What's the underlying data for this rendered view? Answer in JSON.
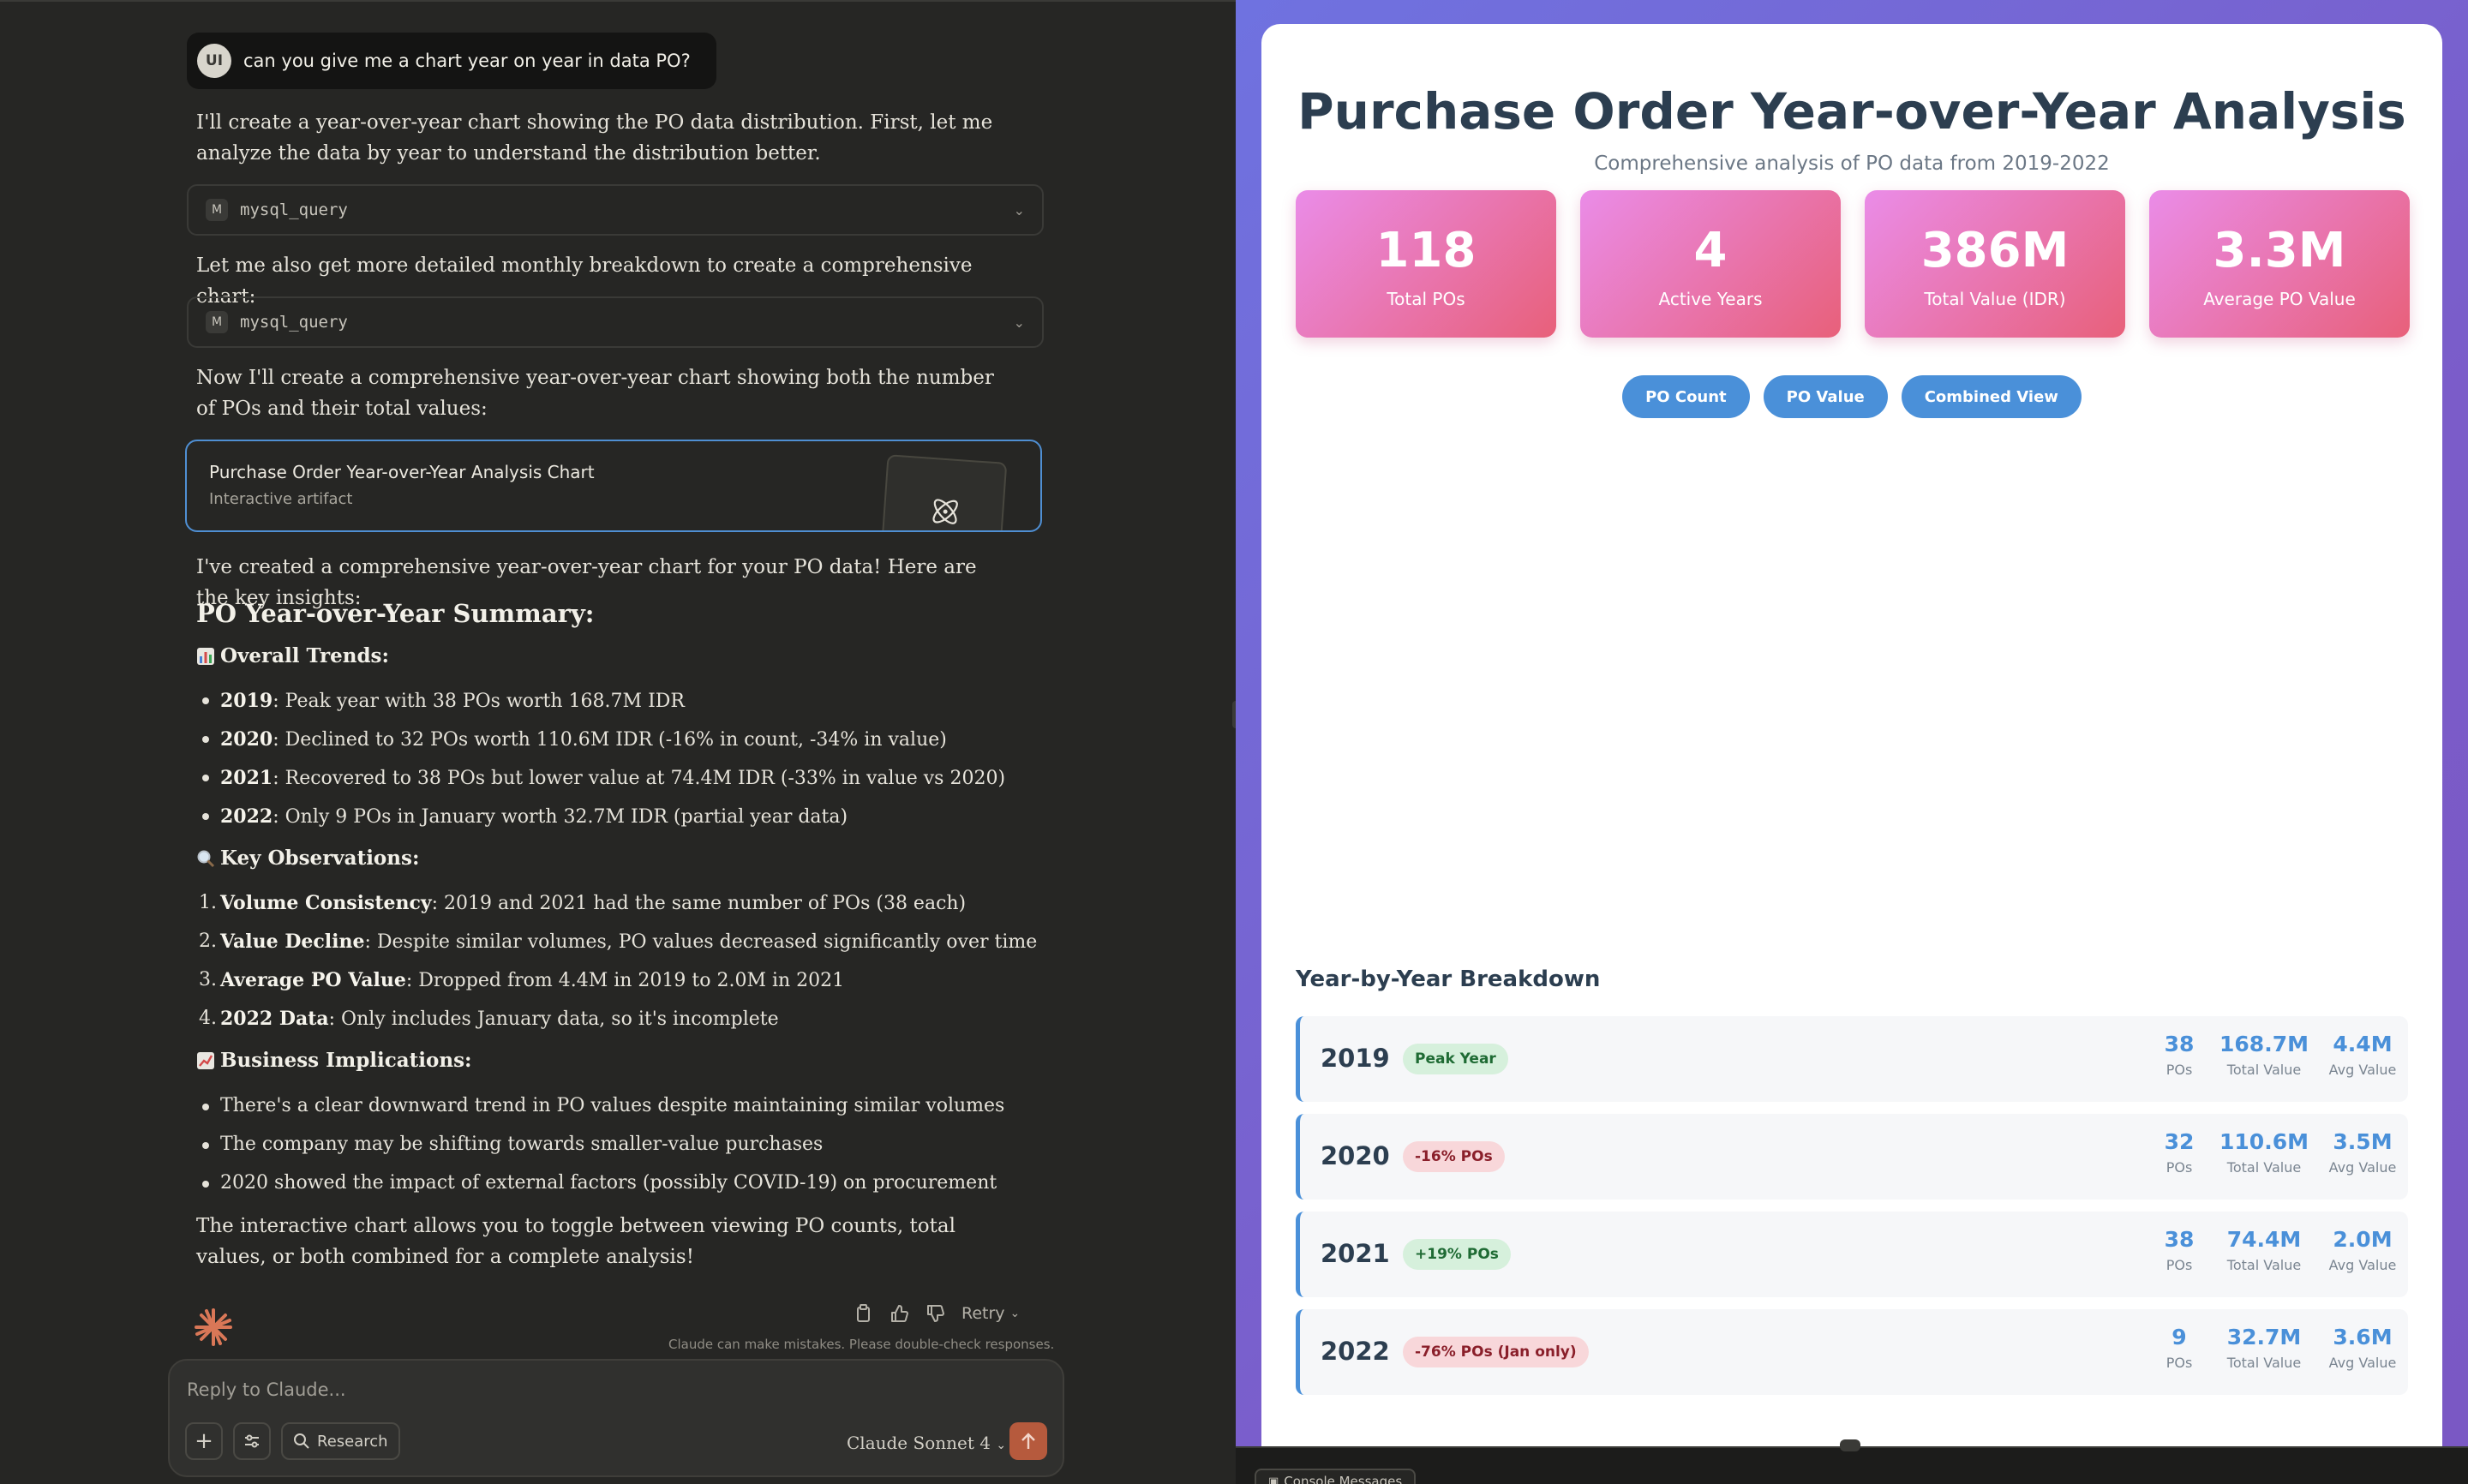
{
  "chat": {
    "user_initials": "UI",
    "user_message": "can you give me a chart year on year in data PO?",
    "para1": "I'll create a year-over-year chart showing the PO data distribution. First, let me analyze the data by year to understand the distribution better.",
    "tool1": {
      "badge": "M",
      "name": "mysql_query"
    },
    "para2": "Let me also get more detailed monthly breakdown to create a comprehensive chart:",
    "tool2": {
      "badge": "M",
      "name": "mysql_query"
    },
    "para3": "Now I'll create a comprehensive year-over-year chart showing both the number of POs and their total values:",
    "artifact_card": {
      "title": "Purchase Order Year-over-Year Analysis Chart",
      "subtitle": "Interactive artifact"
    },
    "para4": "I've created a comprehensive year-over-year chart for your PO data! Here are the key insights:",
    "summary_heading": "PO Year-over-Year Summary:",
    "trends_heading": "Overall Trends:",
    "trends": [
      {
        "key": "2019",
        "text": ": Peak year with 38 POs worth 168.7M IDR"
      },
      {
        "key": "2020",
        "text": ": Declined to 32 POs worth 110.6M IDR (-16% in count, -34% in value)"
      },
      {
        "key": "2021",
        "text": ": Recovered to 38 POs but lower value at 74.4M IDR (-33% in value vs 2020)"
      },
      {
        "key": "2022",
        "text": ": Only 9 POs in January worth 32.7M IDR (partial year data)"
      }
    ],
    "observations_heading": "Key Observations:",
    "observations": [
      {
        "n": "1.",
        "key": "Volume Consistency",
        "text": ": 2019 and 2021 had the same number of POs (38 each)"
      },
      {
        "n": "2.",
        "key": "Value Decline",
        "text": ": Despite similar volumes, PO values decreased significantly over time"
      },
      {
        "n": "3.",
        "key": "Average PO Value",
        "text": ": Dropped from 4.4M in 2019 to 2.0M in 2021"
      },
      {
        "n": "4.",
        "key": "2022 Data",
        "text": ": Only includes January data, so it's incomplete"
      }
    ],
    "implications_heading": "Business Implications:",
    "implications": [
      "There's a clear downward trend in PO values despite maintaining similar volumes",
      "The company may be shifting towards smaller-value purchases",
      "2020 showed the impact of external factors (possibly COVID-19) on procurement"
    ],
    "para5": "The interactive chart allows you to toggle between viewing PO counts, total values, or both combined for a complete analysis!",
    "retry_label": "Retry",
    "disclaimer": "Claude can make mistakes. Please double-check responses.",
    "composer": {
      "placeholder": "Reply to Claude...",
      "research_label": "Research",
      "model_label": "Claude Sonnet 4"
    }
  },
  "artifact": {
    "title": "Purchase Order Year-over-Year Analysis",
    "subtitle": "Comprehensive analysis of PO data from 2019-2022",
    "stats": [
      {
        "value": "118",
        "label": "Total POs"
      },
      {
        "value": "4",
        "label": "Active Years"
      },
      {
        "value": "386M",
        "label": "Total Value (IDR)"
      },
      {
        "value": "3.3M",
        "label": "Average PO Value"
      }
    ],
    "toggles": [
      "PO Count",
      "PO Value",
      "Combined View"
    ],
    "breakdown_title": "Year-by-Year Breakdown",
    "years": [
      {
        "year": "2019",
        "badge": "Peak Year",
        "badge_tone": "green",
        "pos": "38",
        "total": "168.7M",
        "avg": "4.4M"
      },
      {
        "year": "2020",
        "badge": "-16% POs",
        "badge_tone": "red",
        "pos": "32",
        "total": "110.6M",
        "avg": "3.5M"
      },
      {
        "year": "2021",
        "badge": "+19% POs",
        "badge_tone": "green",
        "pos": "38",
        "total": "74.4M",
        "avg": "2.0M"
      },
      {
        "year": "2022",
        "badge": "-76% POs (Jan only)",
        "badge_tone": "red",
        "pos": "9",
        "total": "32.7M",
        "avg": "3.6M"
      }
    ],
    "metric_labels": {
      "pos": "POs",
      "total": "Total Value",
      "avg": "Avg Value"
    },
    "console_label": "Console Messages"
  },
  "colors": {
    "accent": "#4a90d9",
    "stat_from": "#ea8ce8",
    "stat_to": "#e8607a",
    "send": "#b65a3d"
  }
}
